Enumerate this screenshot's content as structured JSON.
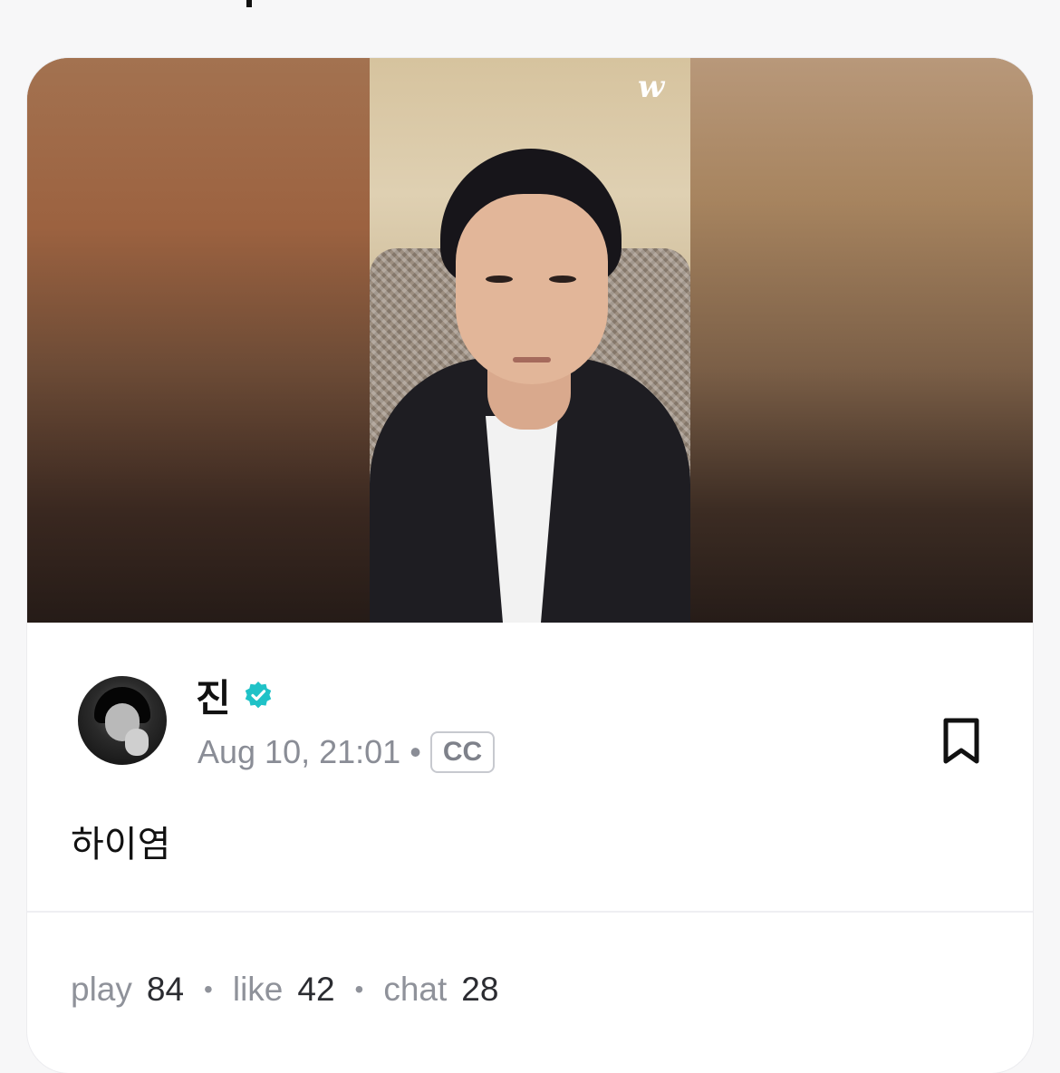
{
  "video": {
    "watermark": "w"
  },
  "post": {
    "author": "진",
    "verified_icon": "verified-badge-icon",
    "date": "Aug 10, 21:01",
    "meta_separator": "•",
    "cc_label": "CC",
    "text": "하이염",
    "bookmark_icon": "bookmark-icon"
  },
  "stats": {
    "play_label": "play",
    "play_count": "84",
    "like_label": "like",
    "like_count": "42",
    "chat_label": "chat",
    "chat_count": "28",
    "separator": "•"
  },
  "colors": {
    "verified": "#1fc2c7",
    "text_primary": "#111111",
    "text_secondary": "#8a8d96"
  }
}
